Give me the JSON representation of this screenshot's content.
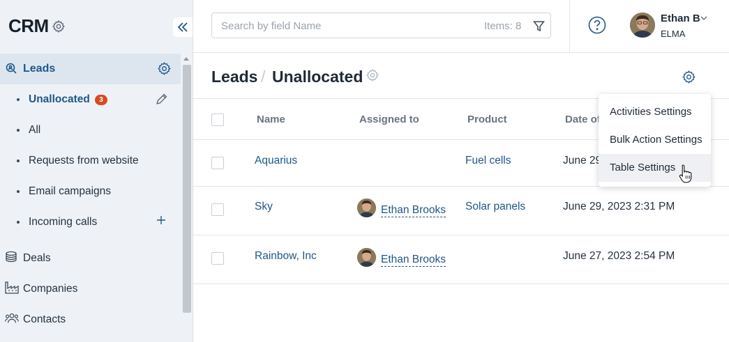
{
  "app": {
    "title": "CRM",
    "collapse_icon": "double-chevron-left-icon"
  },
  "sidebar": {
    "section": {
      "label": "Leads",
      "icon": "search-person-icon"
    },
    "items": [
      {
        "label": "Unallocated",
        "badge": "3",
        "active": true
      },
      {
        "label": "All"
      },
      {
        "label": "Requests from website"
      },
      {
        "label": "Email campaigns"
      },
      {
        "label": "Incoming calls"
      }
    ],
    "main": [
      {
        "label": "Deals",
        "icon": "coins-icon"
      },
      {
        "label": "Companies",
        "icon": "factory-icon"
      },
      {
        "label": "Contacts",
        "icon": "people-icon"
      }
    ]
  },
  "search": {
    "placeholder": "Search by field Name",
    "count": "Items: 8"
  },
  "user": {
    "name": "Ethan B",
    "org": "ELMA"
  },
  "breadcrumb": {
    "parent": "Leads",
    "separator": "/",
    "current": "Unallocated"
  },
  "table": {
    "columns": [
      "Name",
      "Assigned to",
      "Product",
      "Date of"
    ],
    "rows": [
      {
        "name": "Aquarius",
        "assigned": "",
        "product": "Fuel cells",
        "date": "June 29"
      },
      {
        "name": "Sky",
        "assigned": "Ethan Brooks",
        "product": "Solar panels",
        "date": "June 29, 2023 2:31 PM"
      },
      {
        "name": "Rainbow, Inc",
        "assigned": "Ethan Brooks",
        "product": "",
        "date": "June 27, 2023 2:54 PM"
      }
    ]
  },
  "settings_menu": {
    "items": [
      "Activities Settings",
      "Bulk Action Settings",
      "Table Settings"
    ],
    "hovered": "Table Settings"
  },
  "colors": {
    "accent": "#1f5688",
    "badge": "#d94a1e",
    "sidebar_bg": "#eef2f6"
  }
}
